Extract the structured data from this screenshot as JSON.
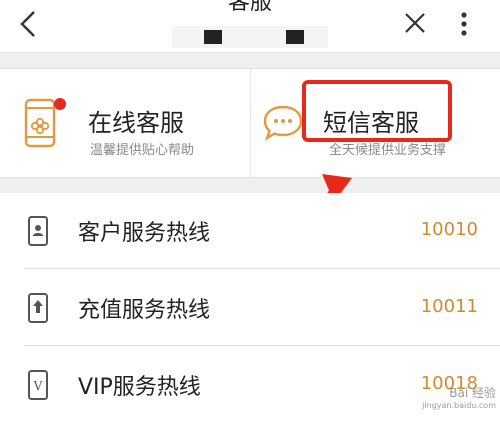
{
  "navbar": {
    "title": "客服",
    "back_icon": "chevron-left-icon",
    "close_icon": "close-icon",
    "more_icon": "more-vertical-icon"
  },
  "cards": [
    {
      "title": "在线客服",
      "subtitle": "温馨提供贴心帮助",
      "icon": "phone-chat-icon"
    },
    {
      "title": "短信客服",
      "subtitle": "全天候提供业务支撑",
      "icon": "message-bubble-icon"
    }
  ],
  "hotlines": [
    {
      "label": "客户服务热线",
      "number": "10010",
      "icon": "phone-user-icon"
    },
    {
      "label": "充值服务热线",
      "number": "10011",
      "icon": "phone-upload-icon"
    },
    {
      "label": "VIP服务热线",
      "number": "10018",
      "icon": "phone-vip-icon"
    }
  ],
  "colors": {
    "accent": "#d48a2c",
    "annotation": "#e8281b",
    "badge": "#e22a1f"
  },
  "watermark": {
    "main": "Bai 经验",
    "sub": "jingyan.baidu.com"
  }
}
